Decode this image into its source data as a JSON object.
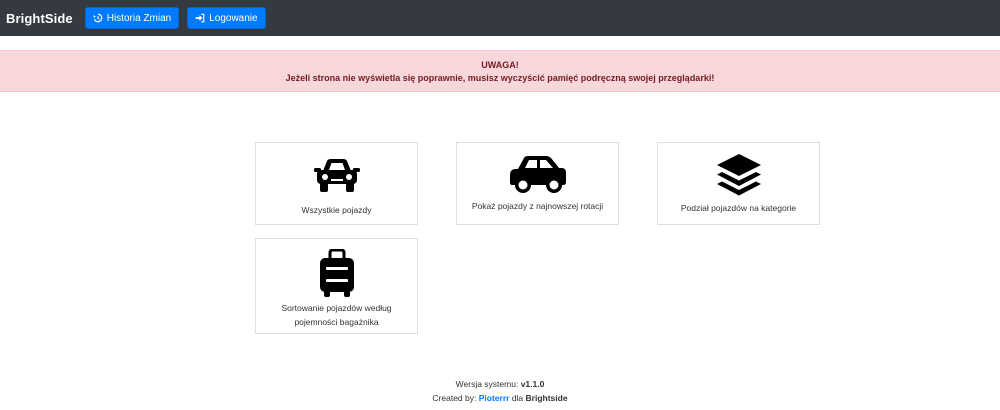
{
  "navbar": {
    "brand": "BrightSide",
    "buttons": [
      {
        "label": "Historia Zmian",
        "icon": "history-icon"
      },
      {
        "label": "Logowanie",
        "icon": "sign-in-icon"
      }
    ]
  },
  "alert": {
    "title": "UWAGA!",
    "message": "Jeżeli strona nie wyświetla się poprawnie, musisz wyczyścić pamięć podręczną swojej przeglądarki!"
  },
  "cards": [
    {
      "label": "Wszystkie pojazdy",
      "icon": "car-front-icon"
    },
    {
      "label": "Pokaż pojazdy z najnowszej rotacji",
      "icon": "car-side-icon"
    },
    {
      "label": "Podział pojazdów na kategorie",
      "icon": "layers-icon"
    },
    {
      "label_line1": "Sortowanie pojazdów według",
      "label_line2": "pojemności bagażnika",
      "icon": "suitcase-icon"
    }
  ],
  "footer": {
    "version_label": "Wersja systemu: ",
    "version": "v1.1.0",
    "created_label": "Created by: ",
    "author": "Pioterrr",
    "for_label": " dla ",
    "company": "Brightside"
  },
  "colors": {
    "navbar": "#343a40",
    "primary": "#007bff",
    "alert_bg": "#f8d7da",
    "alert_text": "#721c24"
  }
}
